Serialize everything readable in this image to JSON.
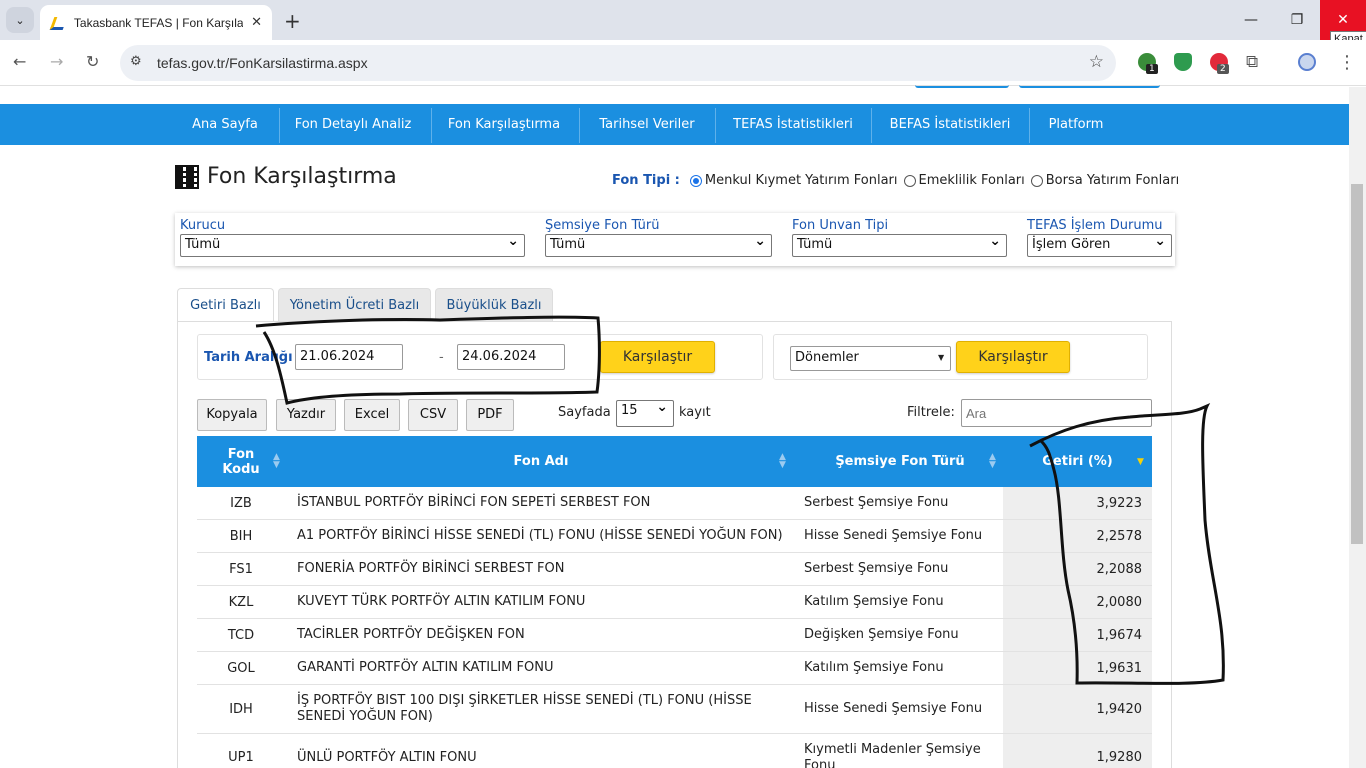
{
  "browser": {
    "tab_title": "Takasbank TEFAS | Fon Karşılaştı",
    "url": "tefas.gov.tr/FonKarsilastirma.aspx",
    "close_tooltip": "Kapat",
    "ext_badge_1": "1",
    "ext_badge_2": "2"
  },
  "nav": {
    "items": [
      "Ana Sayfa",
      "Fon Detaylı Analiz",
      "Fon Karşılaştırma",
      "Tarihsel Veriler",
      "TEFAS İstatistikleri",
      "BEFAS İstatistikleri",
      "Platform"
    ]
  },
  "page": {
    "title": "Fon Karşılaştırma"
  },
  "fon_tipi": {
    "label": "Fon Tipi :",
    "options": [
      "Menkul Kıymet Yatırım Fonları",
      "Emeklilik Fonları",
      "Borsa Yatırım Fonları"
    ],
    "selected": "Menkul Kıymet Yatırım Fonları"
  },
  "filters": [
    {
      "label": "Kurucu",
      "value": "Tümü"
    },
    {
      "label": "Şemsiye Fon Türü",
      "value": "Tümü"
    },
    {
      "label": "Fon Unvan Tipi",
      "value": "Tümü"
    },
    {
      "label": "TEFAS İşlem Durumu",
      "value": "İşlem Gören"
    }
  ],
  "tabs": [
    "Getiri Bazlı",
    "Yönetim Ücreti Bazlı",
    "Büyüklük Bazlı"
  ],
  "date_range": {
    "label": "Tarih Aralığı",
    "start": "21.06.2024",
    "separator": "-",
    "end": "24.06.2024",
    "button": "Karşılaştır"
  },
  "periods": {
    "value": "Dönemler",
    "button": "Karşılaştır"
  },
  "table_tools": {
    "buttons": [
      "Kopyala",
      "Yazdır",
      "Excel",
      "CSV",
      "PDF"
    ],
    "per_page_label": "Sayfada",
    "per_page": "15",
    "per_page_suffix": "kayıt",
    "filter_label": "Filtrele:",
    "filter_placeholder": "Ara"
  },
  "table": {
    "columns": [
      "Fon Kodu",
      "Fon Adı",
      "Şemsiye Fon Türü",
      "Getiri (%)"
    ],
    "rows": [
      {
        "code": "IZB",
        "name": "İSTANBUL PORTFÖY BİRİNCİ FON SEPETİ SERBEST FON",
        "type": "Serbest Şemsiye Fonu",
        "ret": "3,9223"
      },
      {
        "code": "BIH",
        "name": "A1 PORTFÖY BİRİNCİ HİSSE SENEDİ (TL) FONU (HİSSE SENEDİ YOĞUN FON)",
        "type": "Hisse Senedi Şemsiye Fonu",
        "ret": "2,2578"
      },
      {
        "code": "FS1",
        "name": "FONERİA PORTFÖY BİRİNCİ SERBEST FON",
        "type": "Serbest Şemsiye Fonu",
        "ret": "2,2088"
      },
      {
        "code": "KZL",
        "name": "KUVEYT TÜRK PORTFÖY ALTIN KATILIM FONU",
        "type": "Katılım Şemsiye Fonu",
        "ret": "2,0080"
      },
      {
        "code": "TCD",
        "name": "TACİRLER PORTFÖY DEĞİŞKEN FON",
        "type": "Değişken Şemsiye Fonu",
        "ret": "1,9674"
      },
      {
        "code": "GOL",
        "name": "GARANTİ PORTFÖY ALTIN KATILIM FONU",
        "type": "Katılım Şemsiye Fonu",
        "ret": "1,9631"
      },
      {
        "code": "IDH",
        "name": "İŞ PORTFÖY BIST 100 DIŞI ŞİRKETLER HİSSE SENEDİ (TL) FONU (HİSSE SENEDİ YOĞUN FON)",
        "type": "Hisse Senedi Şemsiye Fonu",
        "ret": "1,9420"
      },
      {
        "code": "UP1",
        "name": "ÜNLÜ PORTFÖY ALTIN FONU",
        "type": "Kıymetli Madenler Şemsiye Fonu",
        "ret": "1,9280"
      }
    ]
  }
}
